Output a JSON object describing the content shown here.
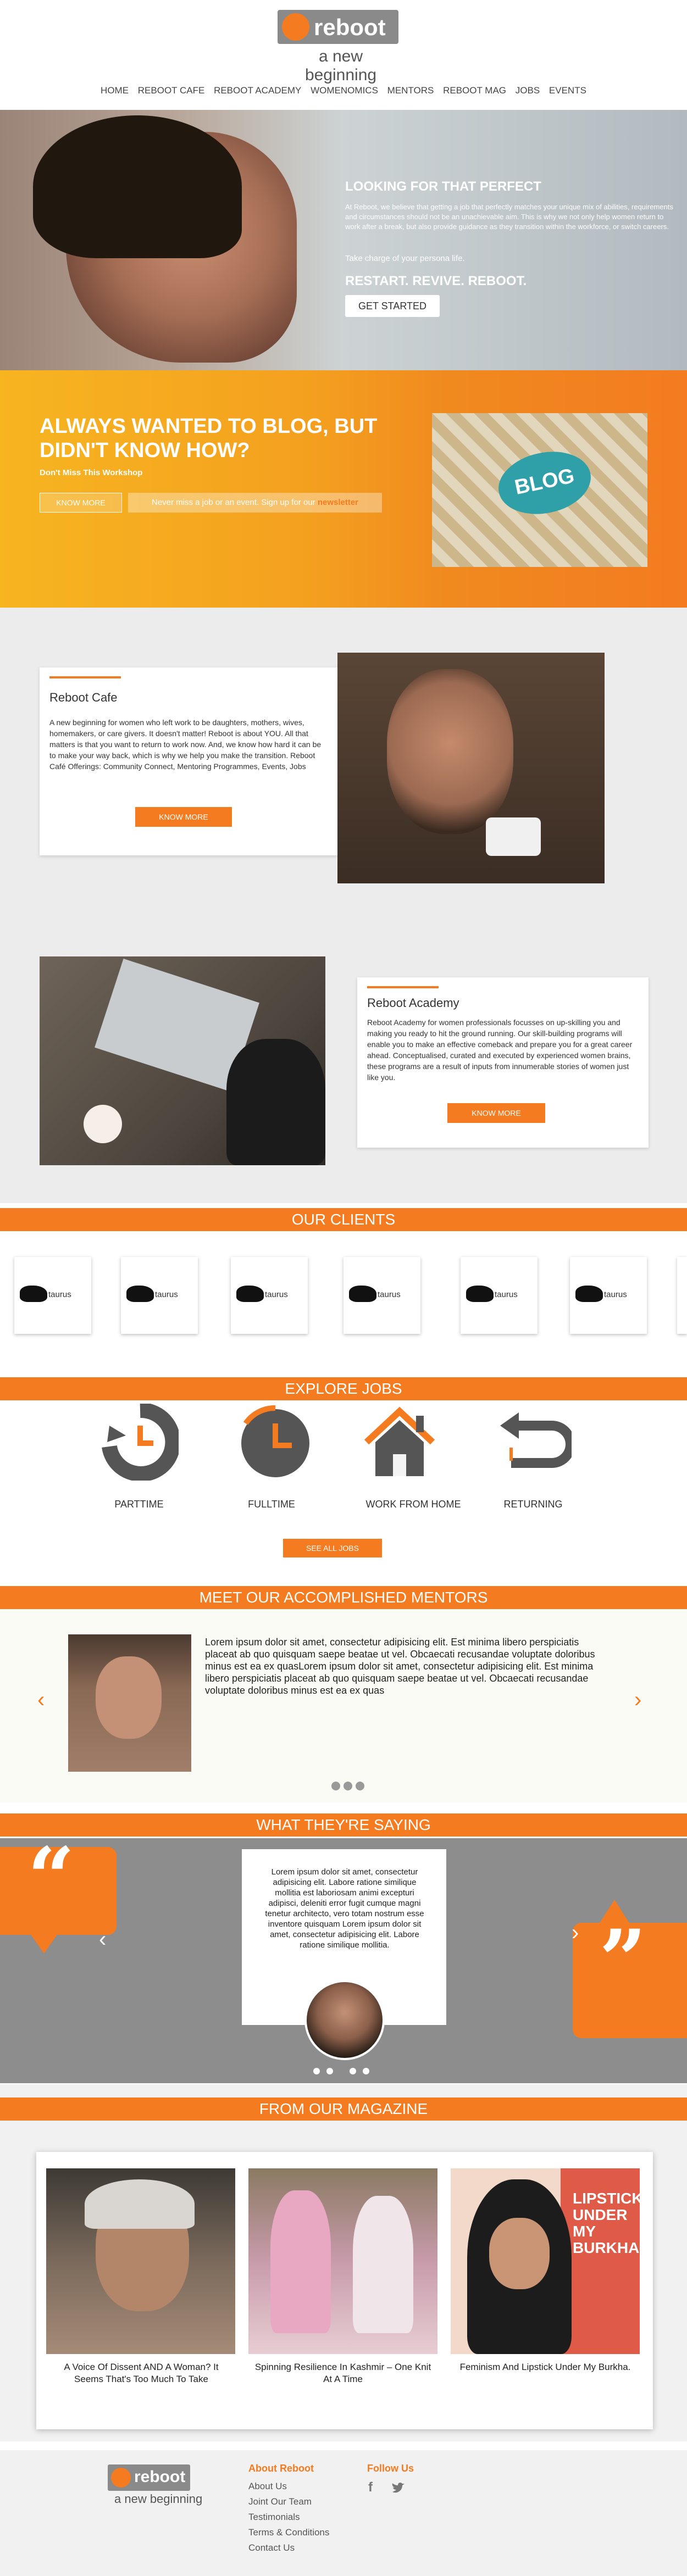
{
  "brand": {
    "name": "reboot",
    "tagline": "a new beginning",
    "accent": "#f47b20",
    "grey": "#8a8a8a"
  },
  "nav": [
    "HOME",
    "REBOOT CAFE",
    "REBOOT ACADEMY",
    "WOMENOMICS",
    "MENTORS",
    "REBOOT MAG",
    "JOBS",
    "EVENTS"
  ],
  "hero": {
    "title": "LOOKING FOR THAT PERFECT",
    "copy": "At Reboot, we believe that getting a job that perfectly matches your unique mix of abilities, requirements and circumstances should not be an unachievable aim. This is why we not only help women return to work after a break, but also provide guidance as they transition within the workforce, or switch careers.",
    "copy2": "Take charge of your persona life.",
    "tagline": "RESTART. REVIVE. REBOOT.",
    "cta": "GET STARTED"
  },
  "blog": {
    "title": "ALWAYS WANTED TO BLOG, BUT DIDN'T KNOW HOW?",
    "subtitle": "Don't Miss This Workshop",
    "know_more": "KNOW MORE",
    "newsletter_text": "Never miss a job or an event. Sign up for our ",
    "newsletter_link": "newsletter",
    "image_label": "BLOG"
  },
  "cafe": {
    "title": "Reboot Cafe",
    "text": "A new beginning for women who left work to be daughters, mothers, wives, homemakers, or care givers. It doesn't matter! Reboot is about YOU. All that matters is that you want to return to work now. And, we know how hard it can be to make your way back, which is why we help you make the transition. Reboot Café Offerings: Community Connect, Mentoring Programmes, Events, Jobs",
    "cta": "KNOW MORE"
  },
  "academy": {
    "title": "Reboot Academy",
    "text": "Reboot Academy for women professionals focusses on up-skilling you and making you ready to hit the ground running. Our skill-building programs will enable you to make an effective comeback and prepare you for a great career ahead. Conceptualised, curated and executed by experienced women brains, these programs are a result of inputs from innumerable stories of women just like you.",
    "cta": "KNOW MORE"
  },
  "clients": {
    "title": "OUR CLIENTS",
    "items": [
      "taurus",
      "taurus",
      "taurus",
      "taurus",
      "taurus",
      "taurus"
    ]
  },
  "jobs": {
    "title": "EXPLORE JOBS",
    "items": [
      {
        "label": "PARTTIME",
        "icon": "refresh-clock-icon"
      },
      {
        "label": "FULLTIME",
        "icon": "clock-icon"
      },
      {
        "label": "WORK FROM HOME",
        "icon": "home-icon"
      },
      {
        "label": "RETURNING",
        "icon": "return-arrow-icon"
      }
    ],
    "cta": "SEE ALL JOBS"
  },
  "mentors": {
    "title": "MEET OUR ACCOMPLISHED MENTORS",
    "text": "Lorem ipsum dolor sit amet, consectetur adipisicing elit. Est minima libero perspiciatis placeat ab quo quisquam saepe beatae ut vel. Obcaecati recusandae voluptate doloribus minus est ea ex quasLorem ipsum dolor sit amet, consectetur adipisicing elit. Est minima libero perspiciatis placeat ab quo quisquam saepe beatae ut vel. Obcaecati recusandae voluptate doloribus minus est ea ex quas"
  },
  "testimonials": {
    "title": "WHAT THEY'RE SAYING",
    "quote": "Lorem ipsum dolor sit amet, consectetur adipisicing elit. Labore ratione similique mollitia est laboriosam animi excepturi adipisci, deleniti error fugit cumque magni tenetur architecto, vero totam nostrum esse inventore quisquam Lorem ipsum dolor sit amet, consectetur adipisicing elit. Labore ratione similique mollitia."
  },
  "magazine": {
    "title": "FROM OUR MAGAZINE",
    "items": [
      {
        "caption": "A Voice Of Dissent AND A Woman? It Seems That's Too Much To Take"
      },
      {
        "caption": "Spinning Resilience In Kashmir – One Knit At A Time"
      },
      {
        "caption": "Feminism And Lipstick Under My Burkha."
      }
    ],
    "lipstick_text": "LIPSTICK UNDER MY BURKHA"
  },
  "footer": {
    "about_title": "About Reboot",
    "links": [
      "About Us",
      "Joint  Our Team",
      "Testimonials",
      "Terms & Conditions",
      "Contact Us"
    ],
    "follow_title": "Follow Us",
    "social": [
      "f",
      "twitter"
    ]
  }
}
